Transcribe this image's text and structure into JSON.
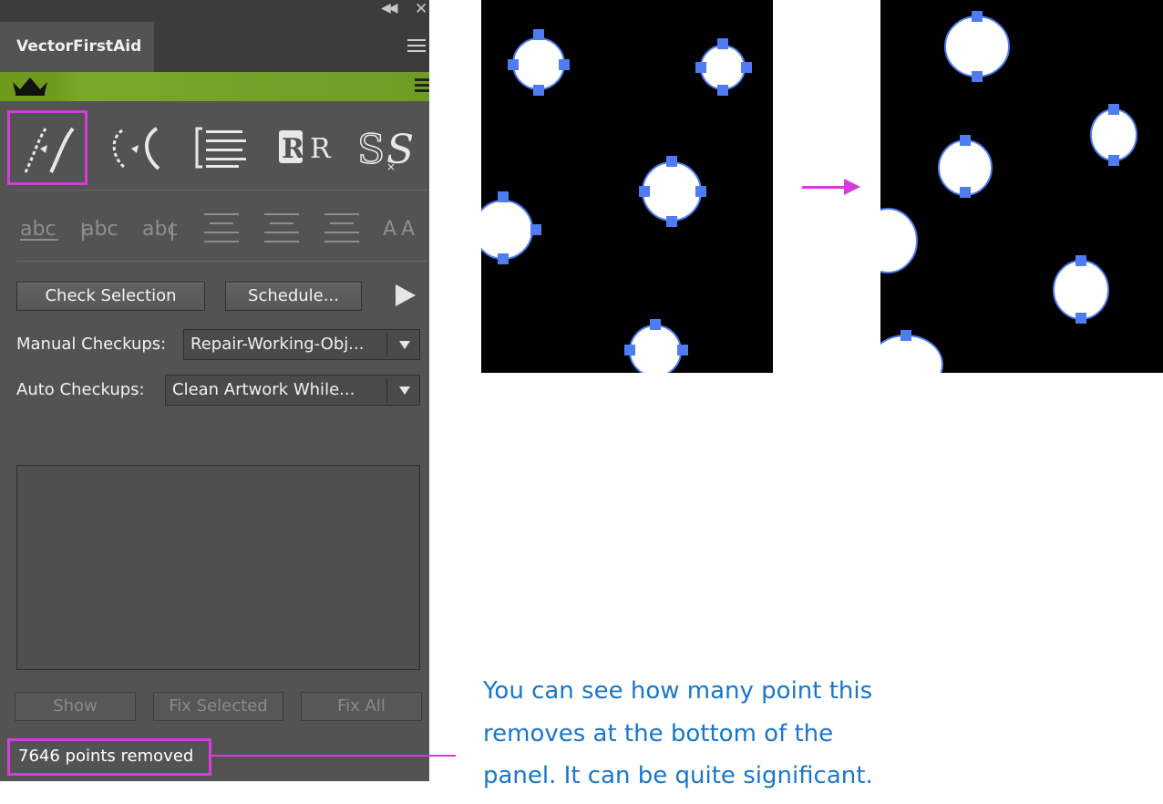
{
  "panel": {
    "title": "VectorFirstAid",
    "collapse_icon": "double-chevron-left-icon",
    "close_icon": "close-icon",
    "tools_row1": [
      "smooth-path-tool-icon",
      "simplify-path-tool-icon",
      "align-text-tool-icon",
      "replace-font-tool-icon",
      "swap-glyph-tool-icon"
    ],
    "tools_row2": [
      "underline-text-icon",
      "underline-text-alt-icon",
      "strike-text-icon",
      "align-top-icon",
      "align-middle-icon",
      "align-bottom-icon",
      "text-scale-icon"
    ],
    "check_selection_label": "Check Selection",
    "schedule_label": "Schedule...",
    "manual_label": "Manual Checkups:",
    "manual_value": "Repair-Working-Obj...",
    "auto_label": "Auto Checkups:",
    "auto_value": "Clean Artwork While...",
    "show_label": "Show",
    "fix_selected_label": "Fix Selected",
    "fix_all_label": "Fix All",
    "status_text": "7646 points removed"
  },
  "note": {
    "line1": "You can see how many point this",
    "line2": "removes at the bottom of the",
    "line3": "panel. It can be quite significant."
  },
  "colors": {
    "accent_magenta": "#d53cd9",
    "handle_blue": "#4f7cf2",
    "note_blue": "#1976c9",
    "brand_green": "#6e9b1e"
  }
}
